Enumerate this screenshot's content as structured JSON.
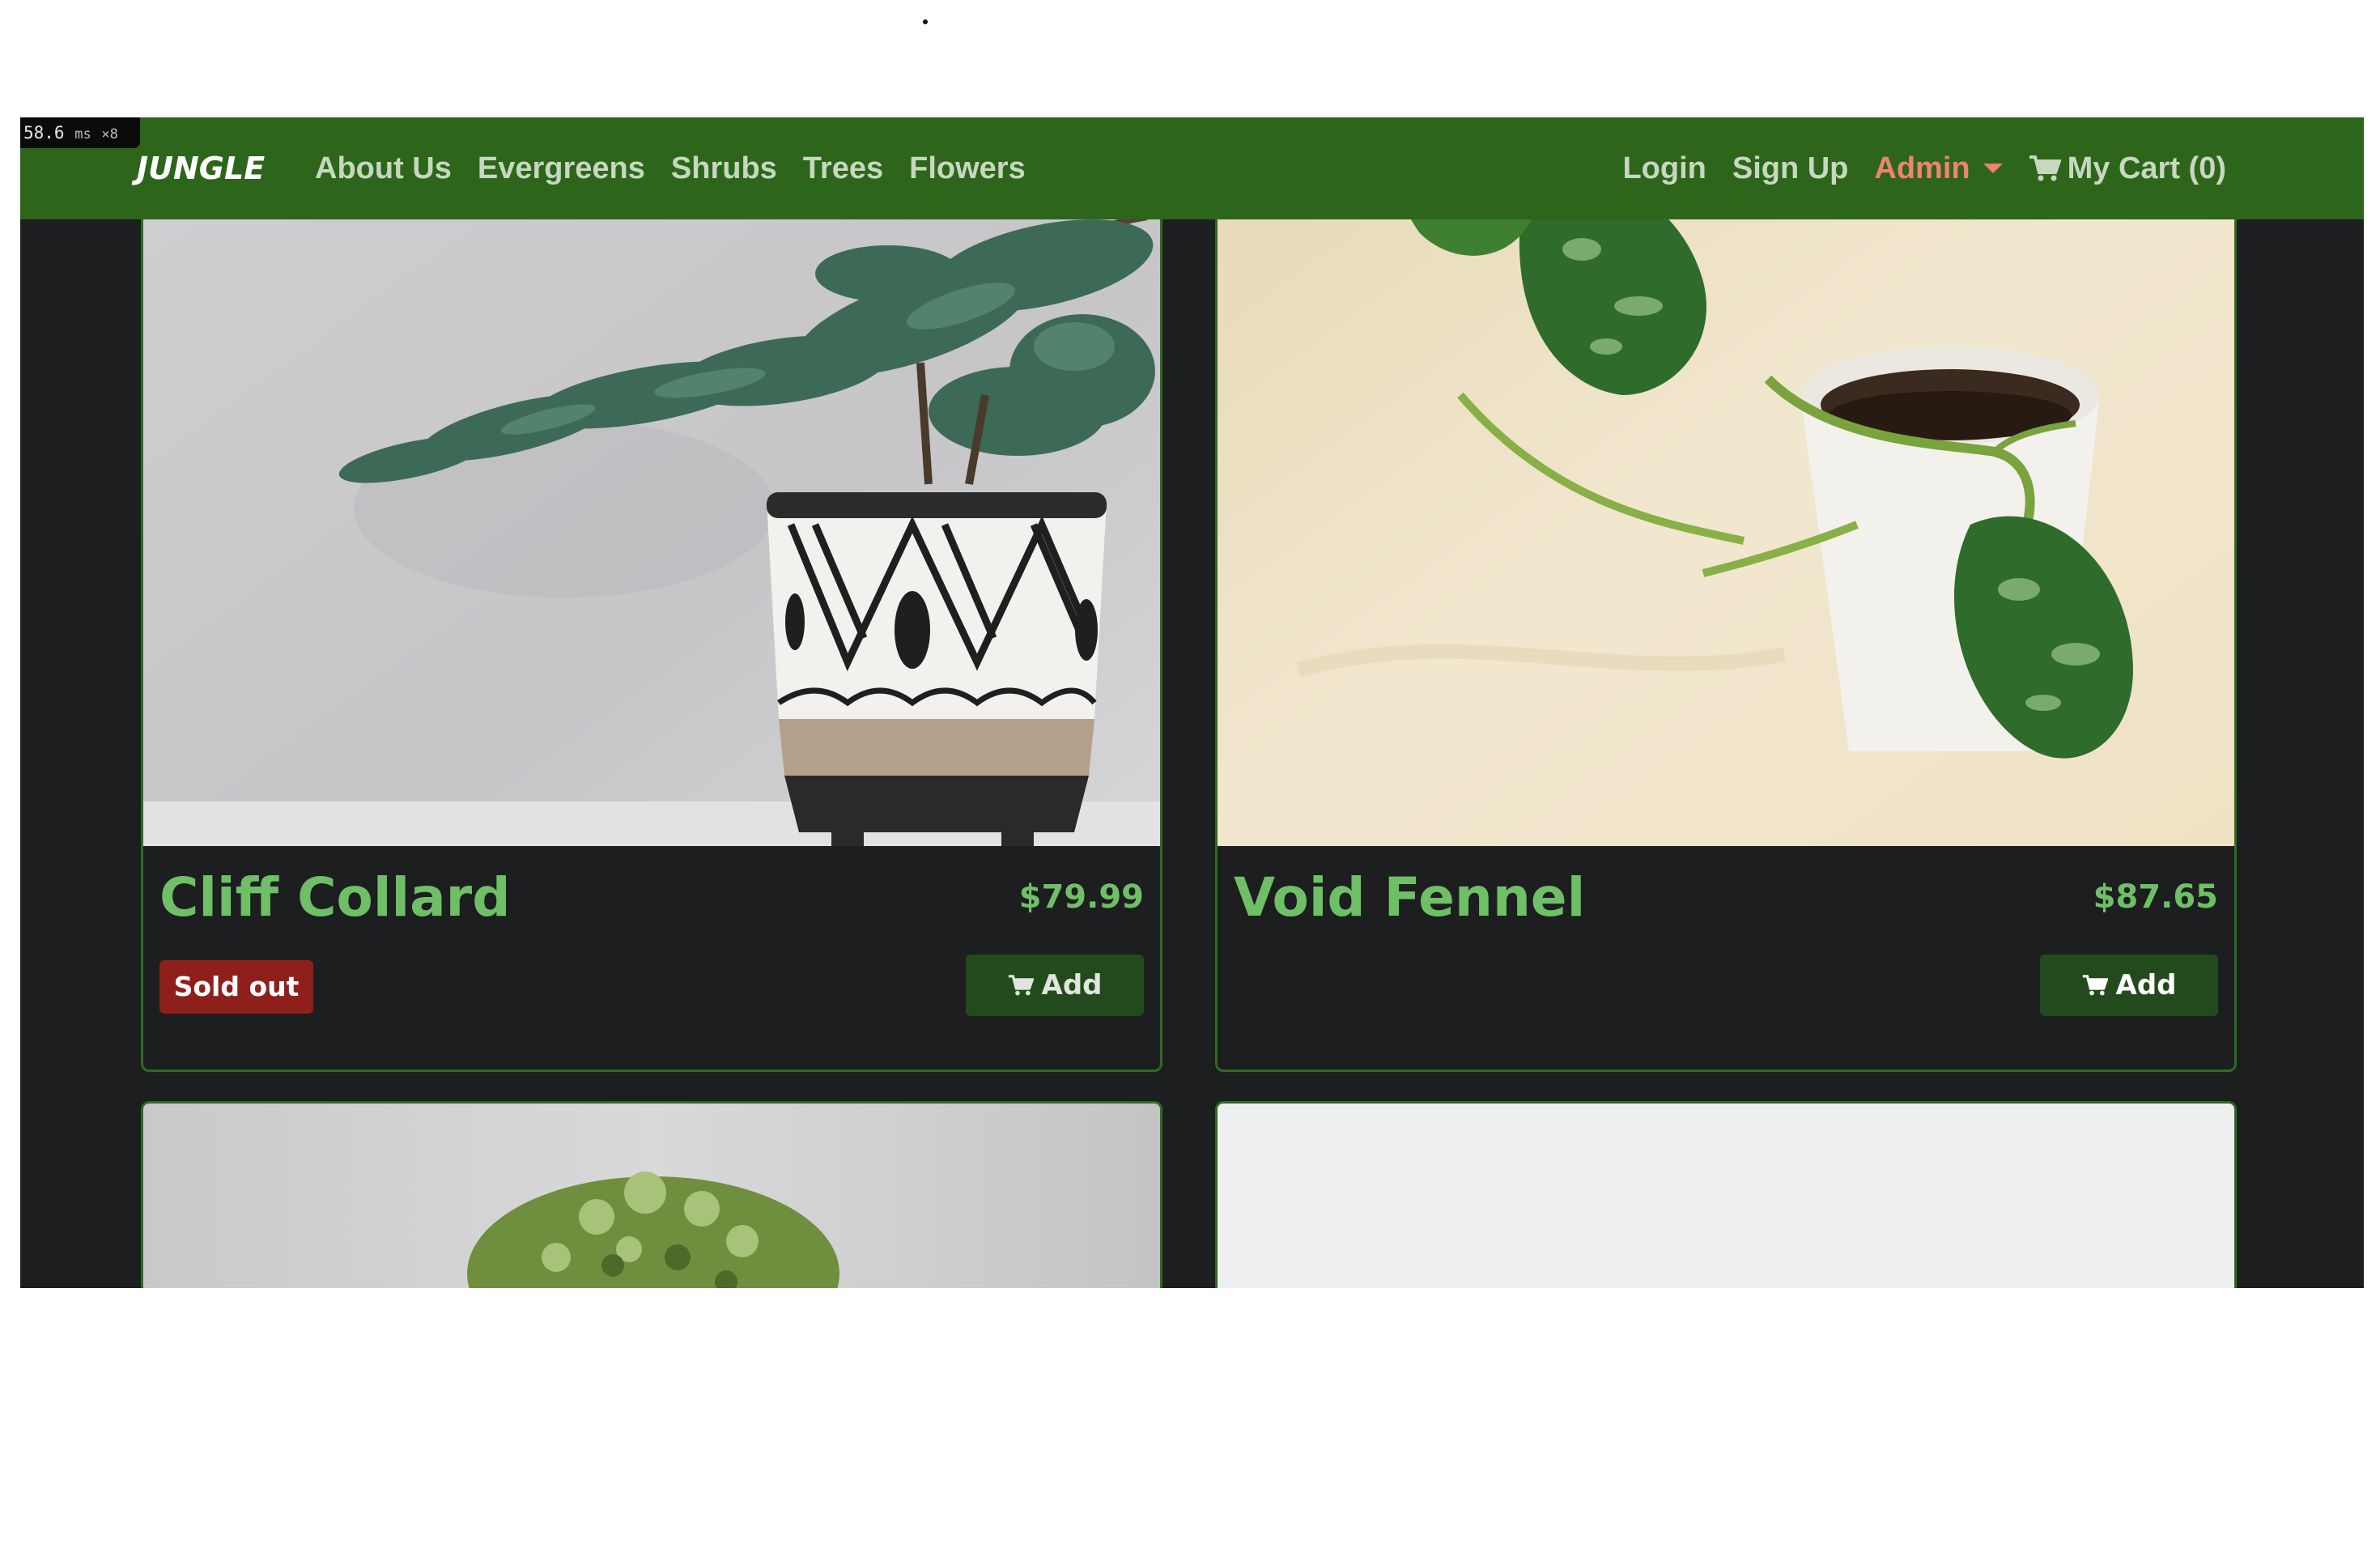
{
  "perf": {
    "value": "58.6",
    "unit": "ms",
    "multiplier": "×8"
  },
  "nav": {
    "brand": "JUNGLE",
    "links": [
      "About Us",
      "Evergreens",
      "Shrubs",
      "Trees",
      "Flowers"
    ],
    "login": "Login",
    "signup": "Sign Up",
    "admin": "Admin",
    "cart": "My Cart (0)"
  },
  "products": [
    {
      "name": "Cliff Collard",
      "price": "$79.99",
      "badge": "Sold out",
      "add_label": "Add",
      "in_stock": false
    },
    {
      "name": "Void Fennel",
      "price": "$87.65",
      "badge": "",
      "add_label": "Add",
      "in_stock": true
    },
    {
      "name": "",
      "price": "",
      "badge": "",
      "add_label": "",
      "in_stock": true
    },
    {
      "name": "",
      "price": "",
      "badge": "",
      "add_label": "",
      "in_stock": true
    }
  ],
  "colors": {
    "navbar": "#2d661a",
    "page_bg": "#1c1e20",
    "accent_green": "#6fbf67",
    "admin_link": "#f08272",
    "sold_out": "#8f1f1a",
    "add_button": "#234a1c"
  }
}
